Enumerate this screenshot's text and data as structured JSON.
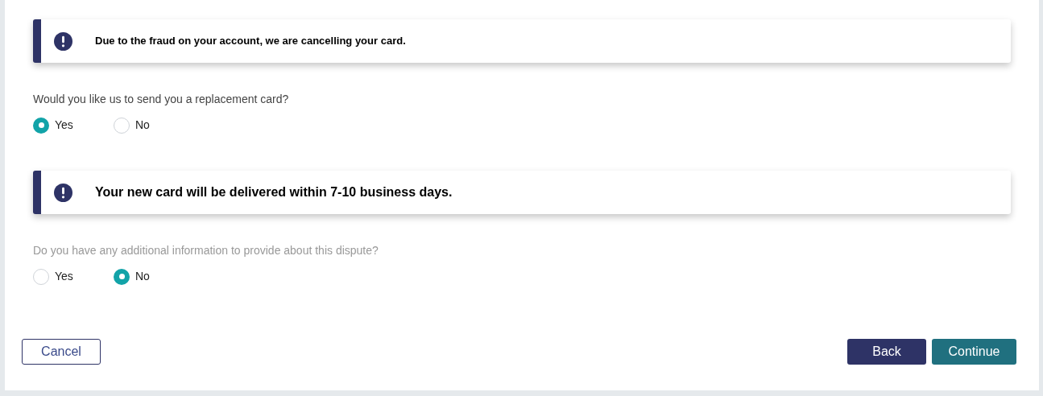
{
  "sections": [
    {
      "alert": {
        "text": "Due to the fraud on your account, we are cancelling your card.",
        "large": false
      },
      "question": {
        "text": "Would you like us to send you a replacement card?",
        "muted": false
      },
      "options": [
        {
          "label": "Yes",
          "selected": true
        },
        {
          "label": "No",
          "selected": false
        }
      ]
    },
    {
      "alert": {
        "text": "Your new card will be delivered within 7-10 business days.",
        "large": true
      },
      "question": {
        "text": "Do you have any additional information to provide about this dispute?",
        "muted": true
      },
      "options": [
        {
          "label": "Yes",
          "selected": false
        },
        {
          "label": "No",
          "selected": true
        }
      ]
    }
  ],
  "buttons": {
    "cancel": "Cancel",
    "back": "Back",
    "continue": "Continue"
  }
}
